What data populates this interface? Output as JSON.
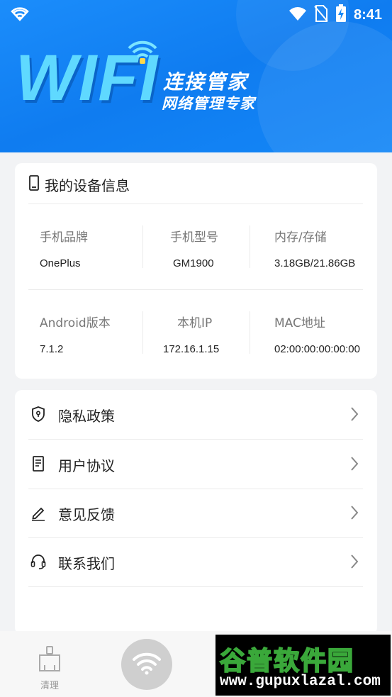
{
  "status_bar": {
    "time": "8:41"
  },
  "banner": {
    "logo_text": "WIFI",
    "title": "连接管家",
    "subtitle": "网络管理专家"
  },
  "device": {
    "header": "我的设备信息",
    "rows": [
      [
        {
          "label": "手机品牌",
          "value": "OnePlus"
        },
        {
          "label": "手机型号",
          "value": "GM1900"
        },
        {
          "label": "内存/存储",
          "value": "3.18GB/21.86GB"
        }
      ],
      [
        {
          "label": "Android版本",
          "value": "7.1.2"
        },
        {
          "label": "本机IP",
          "value": "172.16.1.15"
        },
        {
          "label": "MAC地址",
          "value": "02:00:00:00:00:00"
        }
      ]
    ]
  },
  "menu": {
    "items": [
      {
        "label": "隐私政策",
        "icon": "shield-icon"
      },
      {
        "label": "用户协议",
        "icon": "document-icon"
      },
      {
        "label": "意见反馈",
        "icon": "pencil-icon"
      },
      {
        "label": "联系我们",
        "icon": "headset-icon"
      }
    ]
  },
  "bottom_nav": {
    "clean_label": "清理"
  },
  "watermark": {
    "title": "谷普软件园",
    "url": "www.gupuxlazal.com"
  },
  "colors": {
    "banner": "#1487f7",
    "logo": "#5fd9ff",
    "background": "#f2f3f5"
  }
}
